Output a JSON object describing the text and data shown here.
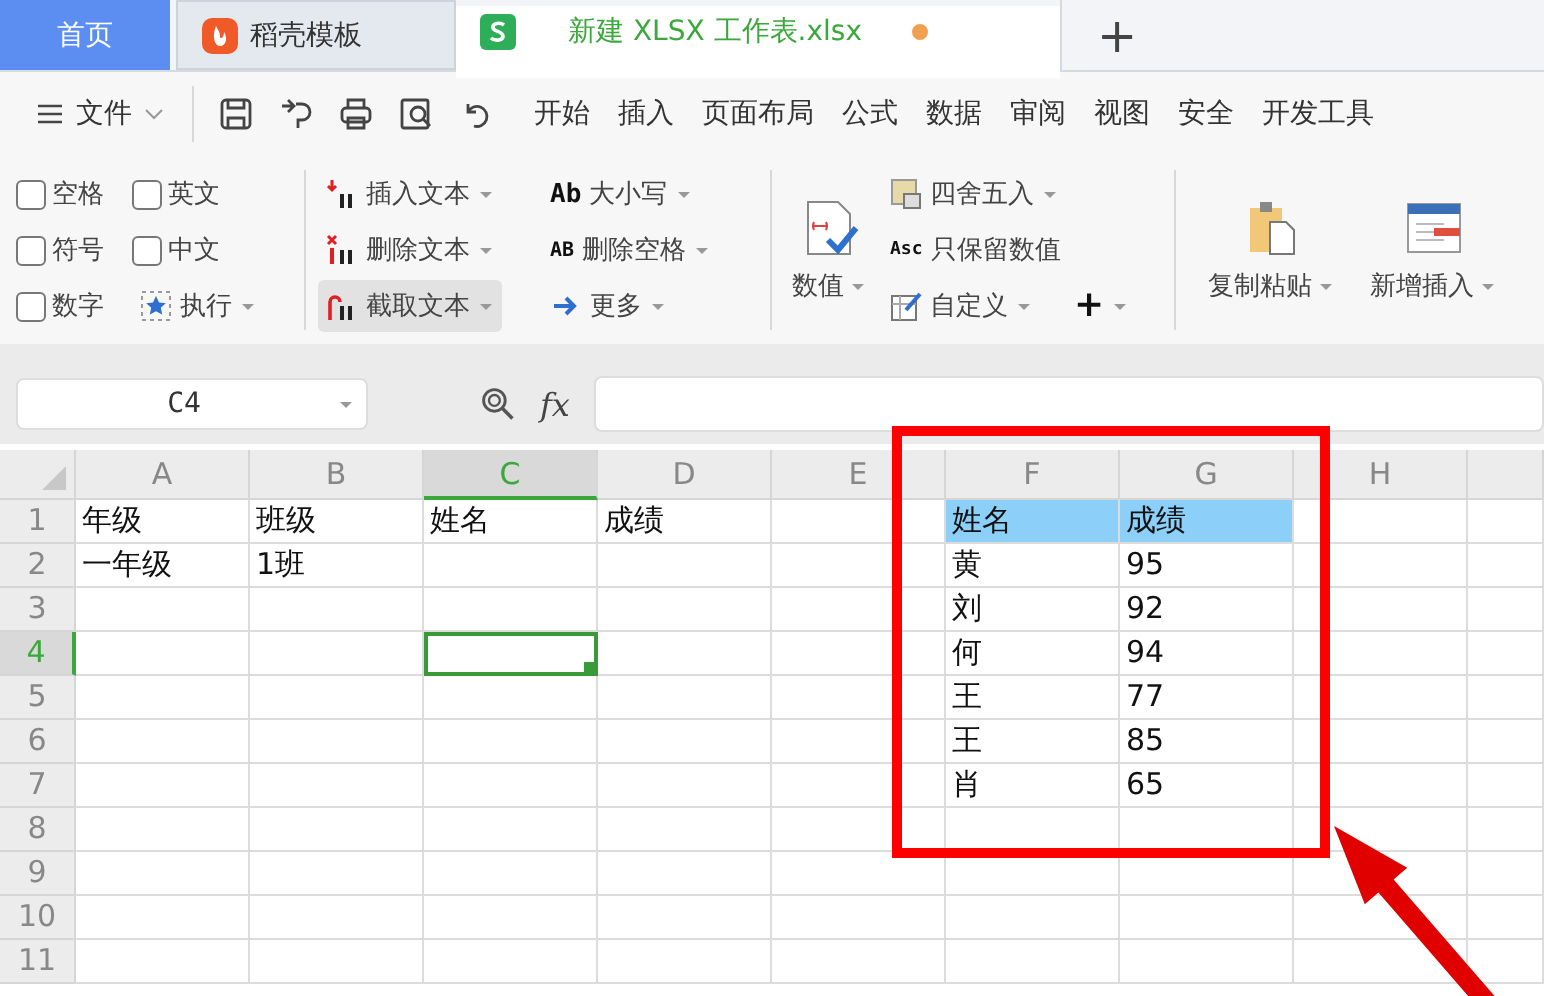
{
  "tabs": [
    {
      "label": "首页",
      "kind": "home",
      "selected": false,
      "unsaved": false
    },
    {
      "label": "稻壳模板",
      "kind": "template",
      "selected": false,
      "unsaved": false
    },
    {
      "label": "新建 XLSX 工作表.xlsx",
      "kind": "sheet",
      "selected": true,
      "unsaved": true
    }
  ],
  "new_tab": "+",
  "menu": {
    "file": "文件",
    "items": [
      "开始",
      "插入",
      "页面布局",
      "公式",
      "数据",
      "审阅",
      "视图",
      "安全",
      "开发工具"
    ]
  },
  "ribbon": {
    "checkboxes": [
      {
        "label": "空格",
        "checked": false
      },
      {
        "label": "英文",
        "checked": false
      },
      {
        "label": "符号",
        "checked": false
      },
      {
        "label": "中文",
        "checked": false
      },
      {
        "label": "数字",
        "checked": false
      }
    ],
    "run": {
      "label": "执行"
    },
    "text_tools": [
      {
        "label": "插入文本",
        "kind": "insert",
        "pressed": false
      },
      {
        "label": "大小写",
        "kind": "case",
        "icon_text": "Ab",
        "pressed": false
      },
      {
        "label": "删除文本",
        "kind": "delete",
        "pressed": false
      },
      {
        "label": "删除空格",
        "kind": "delete-space",
        "icon_text": "AB",
        "pressed": false
      },
      {
        "label": "截取文本",
        "kind": "extract",
        "pressed": true
      },
      {
        "label": "更多",
        "kind": "more",
        "pressed": false
      }
    ],
    "number_button": {
      "label": "数值"
    },
    "number_tools": [
      {
        "label": "四舍五入",
        "kind": "round",
        "dropdown": true
      },
      {
        "label": "只保留数值",
        "kind": "keep",
        "icon_text": "Asc",
        "dropdown": false
      },
      {
        "label": "自定义",
        "kind": "custom",
        "dropdown": true
      },
      {
        "label": "+",
        "kind": "add",
        "dropdown": true
      }
    ],
    "big_buttons": [
      {
        "label": "复制粘贴",
        "kind": "paste",
        "dropdown": true
      },
      {
        "label": "新增插入",
        "kind": "insert-row",
        "dropdown": true
      }
    ]
  },
  "formula_bar": {
    "name_box": "C4",
    "function_label": "fx"
  },
  "sheet": {
    "columns": [
      {
        "label": "A",
        "selected": false
      },
      {
        "label": "B",
        "selected": false
      },
      {
        "label": "C",
        "selected": true
      },
      {
        "label": "D",
        "selected": false
      },
      {
        "label": "E",
        "selected": false
      },
      {
        "label": "F",
        "selected": false
      },
      {
        "label": "G",
        "selected": false
      },
      {
        "label": "H",
        "selected": false
      }
    ],
    "rows": [
      {
        "number": "1",
        "selected": false,
        "cells": [
          {
            "text": "年级",
            "highlighted": false
          },
          {
            "text": "班级",
            "highlighted": false
          },
          {
            "text": "姓名",
            "highlighted": false
          },
          {
            "text": "成绩",
            "highlighted": false
          },
          {
            "text": "",
            "highlighted": false
          },
          {
            "text": "姓名",
            "highlighted": true
          },
          {
            "text": "成绩",
            "highlighted": true
          },
          {
            "text": "",
            "highlighted": false
          }
        ]
      },
      {
        "number": "2",
        "selected": false,
        "cells": [
          {
            "text": "一年级",
            "highlighted": false
          },
          {
            "text": "1班",
            "highlighted": false
          },
          {
            "text": "",
            "highlighted": false
          },
          {
            "text": "",
            "highlighted": false
          },
          {
            "text": "",
            "highlighted": false
          },
          {
            "text": "黄",
            "highlighted": false
          },
          {
            "text": "95",
            "highlighted": false
          },
          {
            "text": "",
            "highlighted": false
          }
        ]
      },
      {
        "number": "3",
        "selected": false,
        "cells": [
          {
            "text": "",
            "highlighted": false
          },
          {
            "text": "",
            "highlighted": false
          },
          {
            "text": "",
            "highlighted": false
          },
          {
            "text": "",
            "highlighted": false
          },
          {
            "text": "",
            "highlighted": false
          },
          {
            "text": "刘",
            "highlighted": false
          },
          {
            "text": "92",
            "highlighted": false
          },
          {
            "text": "",
            "highlighted": false
          }
        ]
      },
      {
        "number": "4",
        "selected": true,
        "cells": [
          {
            "text": "",
            "highlighted": false
          },
          {
            "text": "",
            "highlighted": false
          },
          {
            "text": "",
            "highlighted": false
          },
          {
            "text": "",
            "highlighted": false
          },
          {
            "text": "",
            "highlighted": false
          },
          {
            "text": "何",
            "highlighted": false
          },
          {
            "text": "94",
            "highlighted": false
          },
          {
            "text": "",
            "highlighted": false
          }
        ]
      },
      {
        "number": "5",
        "selected": false,
        "cells": [
          {
            "text": "",
            "highlighted": false
          },
          {
            "text": "",
            "highlighted": false
          },
          {
            "text": "",
            "highlighted": false
          },
          {
            "text": "",
            "highlighted": false
          },
          {
            "text": "",
            "highlighted": false
          },
          {
            "text": "王",
            "highlighted": false
          },
          {
            "text": "77",
            "highlighted": false
          },
          {
            "text": "",
            "highlighted": false
          }
        ]
      },
      {
        "number": "6",
        "selected": false,
        "cells": [
          {
            "text": "",
            "highlighted": false
          },
          {
            "text": "",
            "highlighted": false
          },
          {
            "text": "",
            "highlighted": false
          },
          {
            "text": "",
            "highlighted": false
          },
          {
            "text": "",
            "highlighted": false
          },
          {
            "text": "王",
            "highlighted": false
          },
          {
            "text": "85",
            "highlighted": false
          },
          {
            "text": "",
            "highlighted": false
          }
        ]
      },
      {
        "number": "7",
        "selected": false,
        "cells": [
          {
            "text": "",
            "highlighted": false
          },
          {
            "text": "",
            "highlighted": false
          },
          {
            "text": "",
            "highlighted": false
          },
          {
            "text": "",
            "highlighted": false
          },
          {
            "text": "",
            "highlighted": false
          },
          {
            "text": "肖",
            "highlighted": false
          },
          {
            "text": "65",
            "highlighted": false
          },
          {
            "text": "",
            "highlighted": false
          }
        ]
      },
      {
        "number": "8",
        "selected": false
      },
      {
        "number": "9",
        "selected": false
      },
      {
        "number": "10",
        "selected": false
      },
      {
        "number": "11",
        "selected": false
      }
    ]
  }
}
